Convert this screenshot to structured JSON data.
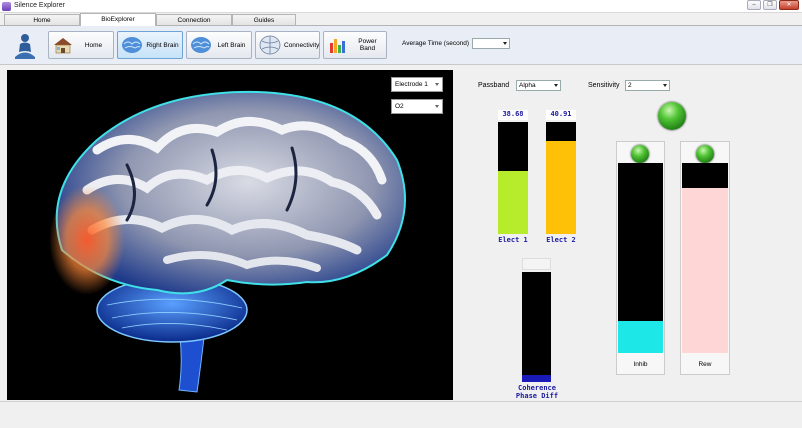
{
  "window": {
    "title": "Silence Explorer",
    "minimize": "‒",
    "maximize": "❐",
    "close": "✕"
  },
  "tabs": [
    {
      "label": "Home"
    },
    {
      "label": "BioExplorer"
    },
    {
      "label": "Connection"
    },
    {
      "label": "Guides"
    }
  ],
  "toolbar": {
    "buttons": [
      {
        "label": "Home",
        "icon": "house-icon"
      },
      {
        "label": "Right Brain",
        "icon": "brain-icon"
      },
      {
        "label": "Left Brain",
        "icon": "brain-icon"
      },
      {
        "label": "Connectivity",
        "icon": "connectivity-icon"
      },
      {
        "label": "Power Band",
        "icon": "bar-chart-icon"
      }
    ],
    "avg_time_label": "Average Time (second)",
    "avg_time_value": ""
  },
  "viewer": {
    "electrode_select": "Electrode 1",
    "channel_select": "O2"
  },
  "controls": {
    "passband_label": "Passband",
    "passband_value": "Alpha",
    "sensitivity_label": "Sensitivity",
    "sensitivity_value": "2"
  },
  "elect_bars": [
    {
      "value": "38.68",
      "caption": "Elect 1",
      "fill_fraction": 0.56,
      "color": "#b6ec2b"
    },
    {
      "value": "40.91",
      "caption": "Elect 2",
      "fill_fraction": 0.83,
      "color": "#ffc107"
    }
  ],
  "coherence": {
    "caption_line1": "Coherence",
    "caption_line2": "Phase Diff",
    "fill_fraction": 0.06,
    "color": "#1a1ab8"
  },
  "feedback_columns": [
    {
      "label": "Inhib",
      "fill_fraction": 0.17,
      "color": "#1de7e7"
    },
    {
      "label": "Rew",
      "fill_fraction": 0.87,
      "color": "#ffd6d6"
    }
  ],
  "colors": {
    "accent": "#6ea3d6",
    "value_text": "#1a1aa0"
  }
}
